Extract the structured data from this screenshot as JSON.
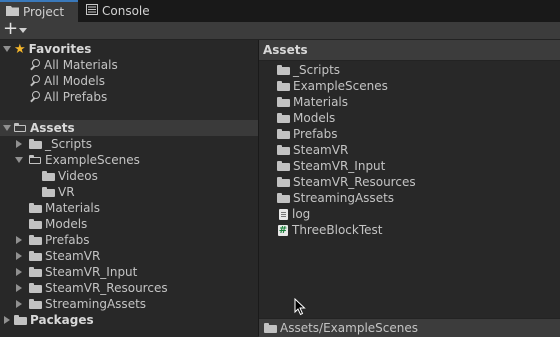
{
  "tabs": [
    {
      "label": "Project",
      "icon": "folder-icon",
      "active": true
    },
    {
      "label": "Console",
      "icon": "console-icon",
      "active": false
    }
  ],
  "toolbar": {
    "create_label": "+"
  },
  "tree": {
    "favorites": {
      "label": "Favorites",
      "items": [
        "All Materials",
        "All Models",
        "All Prefabs"
      ]
    },
    "assets": {
      "label": "Assets",
      "children": [
        {
          "label": "_Scripts",
          "expanded": false
        },
        {
          "label": "ExampleScenes",
          "expanded": true,
          "children": [
            "Videos",
            "VR"
          ]
        },
        {
          "label": "Materials"
        },
        {
          "label": "Models"
        },
        {
          "label": "Prefabs",
          "expanded": false
        },
        {
          "label": "SteamVR",
          "expanded": false
        },
        {
          "label": "SteamVR_Input",
          "expanded": false
        },
        {
          "label": "SteamVR_Resources",
          "expanded": false
        },
        {
          "label": "StreamingAssets",
          "expanded": false
        }
      ]
    },
    "packages": {
      "label": "Packages"
    }
  },
  "content": {
    "header": "Assets",
    "items": [
      {
        "label": "_Scripts",
        "icon": "folder-icon"
      },
      {
        "label": "ExampleScenes",
        "icon": "folder-icon"
      },
      {
        "label": "Materials",
        "icon": "folder-icon"
      },
      {
        "label": "Models",
        "icon": "folder-icon"
      },
      {
        "label": "Prefabs",
        "icon": "folder-icon"
      },
      {
        "label": "SteamVR",
        "icon": "folder-icon"
      },
      {
        "label": "SteamVR_Input",
        "icon": "folder-icon"
      },
      {
        "label": "SteamVR_Resources",
        "icon": "folder-icon"
      },
      {
        "label": "StreamingAssets",
        "icon": "folder-icon"
      },
      {
        "label": "log",
        "icon": "text-file-icon"
      },
      {
        "label": "ThreeBlockTest",
        "icon": "csharp-script-icon"
      }
    ],
    "status_path": "Assets/ExampleScenes"
  },
  "colors": {
    "accent": "#3a79bb",
    "star": "#f4b62b",
    "panel": "#282828",
    "header": "#3c3c3c"
  }
}
